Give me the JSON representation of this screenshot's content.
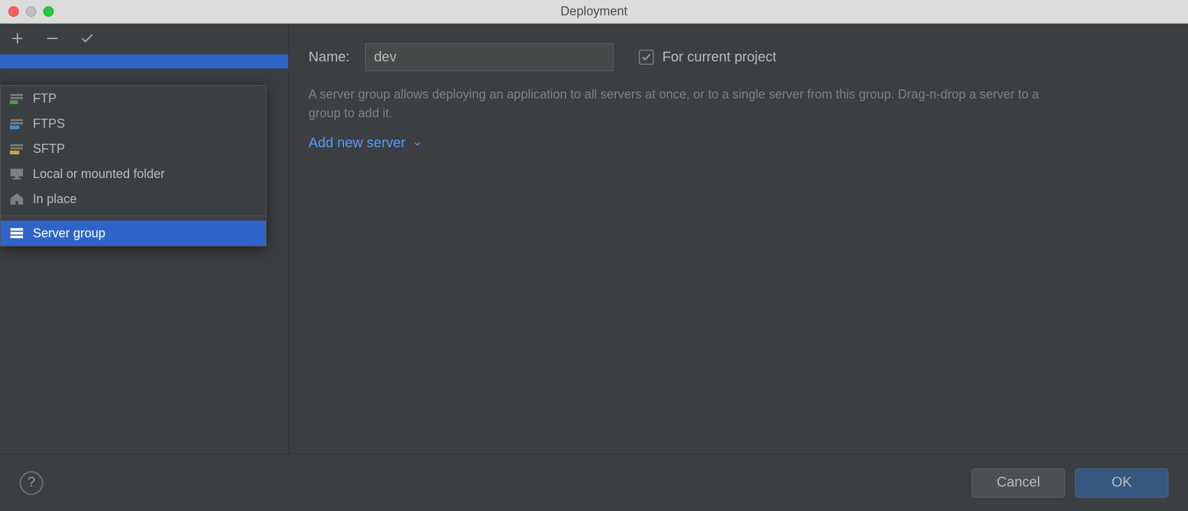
{
  "window": {
    "title": "Deployment"
  },
  "toolbar": {
    "add_tooltip": "Add",
    "remove_tooltip": "Remove",
    "default_tooltip": "Set as default"
  },
  "popup": {
    "items": [
      {
        "label": "FTP",
        "icon": "ftp-icon",
        "badge_color": "#499c54"
      },
      {
        "label": "FTPS",
        "icon": "ftps-icon",
        "badge_color": "#3592c4"
      },
      {
        "label": "SFTP",
        "icon": "sftp-icon",
        "badge_color": "#c9a83f"
      },
      {
        "label": "Local or mounted folder",
        "icon": "folder-icon"
      },
      {
        "label": "In place",
        "icon": "home-icon"
      }
    ],
    "group_item": {
      "label": "Server group",
      "icon": "server-group-icon",
      "selected": true
    }
  },
  "form": {
    "name_label": "Name:",
    "name_value": "dev",
    "for_current_project_label": "For current project",
    "for_current_project_checked": true,
    "description": "A server group allows deploying an application to all servers at once, or to a single server from this group. Drag-n-drop a server to a group to add it.",
    "add_server_label": "Add new server"
  },
  "footer": {
    "cancel": "Cancel",
    "ok": "OK"
  }
}
